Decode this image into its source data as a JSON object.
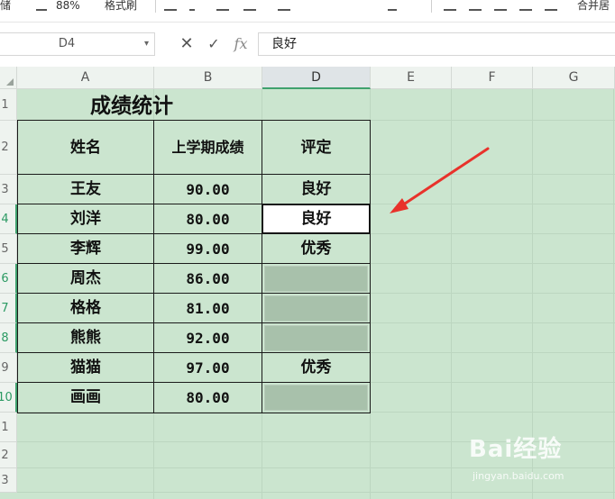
{
  "toolbar": {
    "partial_labels": [
      "储",
      "88%",
      "格式刷",
      "合并居"
    ]
  },
  "formula_bar": {
    "name_box": "D4",
    "cancel_icon": "close-icon",
    "confirm_icon": "check-icon",
    "fx_label": "fx",
    "value": "良好"
  },
  "columns": [
    "A",
    "B",
    "D",
    "E",
    "F",
    "G"
  ],
  "active_column": "D",
  "rows": [
    "1",
    "2",
    "3",
    "4",
    "5",
    "6",
    "7",
    "8",
    "9",
    "10",
    "1",
    "2",
    "3"
  ],
  "sheet": {
    "title": "成绩统计",
    "headers": [
      "姓名",
      "上学期成绩",
      "评定"
    ],
    "records": [
      {
        "name": "王友",
        "score": "90.00",
        "grade": "良好"
      },
      {
        "name": "刘洋",
        "score": "80.00",
        "grade": "良好"
      },
      {
        "name": "李辉",
        "score": "99.00",
        "grade": "优秀"
      },
      {
        "name": "周杰",
        "score": "86.00",
        "grade": ""
      },
      {
        "name": "格格",
        "score": "81.00",
        "grade": ""
      },
      {
        "name": "熊熊",
        "score": "92.00",
        "grade": ""
      },
      {
        "name": "猫猫",
        "score": "97.00",
        "grade": "优秀"
      },
      {
        "name": "画画",
        "score": "80.00",
        "grade": ""
      }
    ]
  },
  "colors": {
    "sheet_background": "#cbe5cf",
    "shaded_cell": "#a8c1ab",
    "selected_cell": "#ffffff",
    "annotation_arrow": "#e8322b"
  },
  "watermark": {
    "brand": "Bai经验",
    "url": "jingyan.baidu.com"
  }
}
